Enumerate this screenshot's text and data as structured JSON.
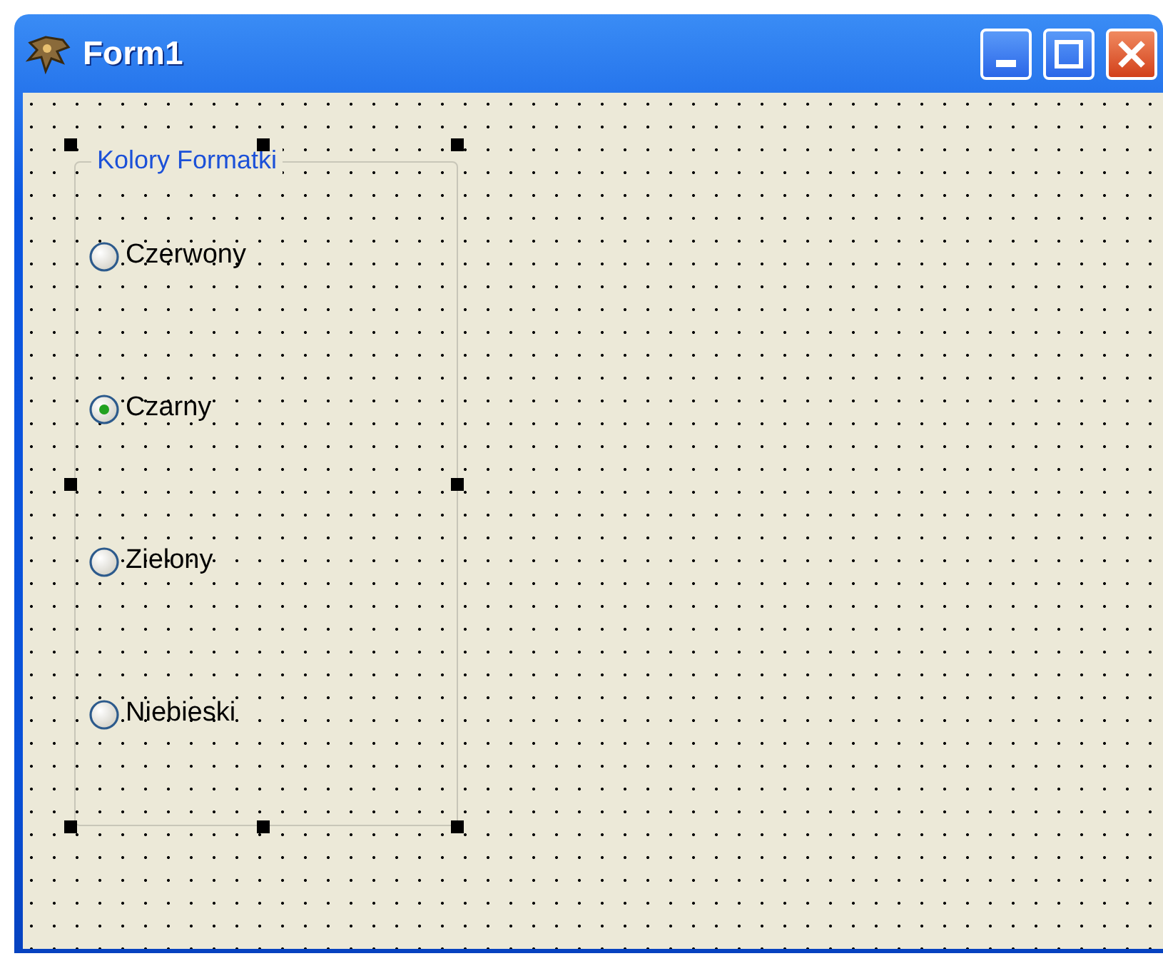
{
  "window": {
    "title": "Form1"
  },
  "group_box": {
    "title": "Kolory Formatki",
    "selected": true,
    "options": [
      {
        "label": "Czerwony",
        "selected": false
      },
      {
        "label": "Czarny",
        "selected": true
      },
      {
        "label": "Zielony",
        "selected": false
      },
      {
        "label": "Niebieski",
        "selected": false
      }
    ]
  }
}
